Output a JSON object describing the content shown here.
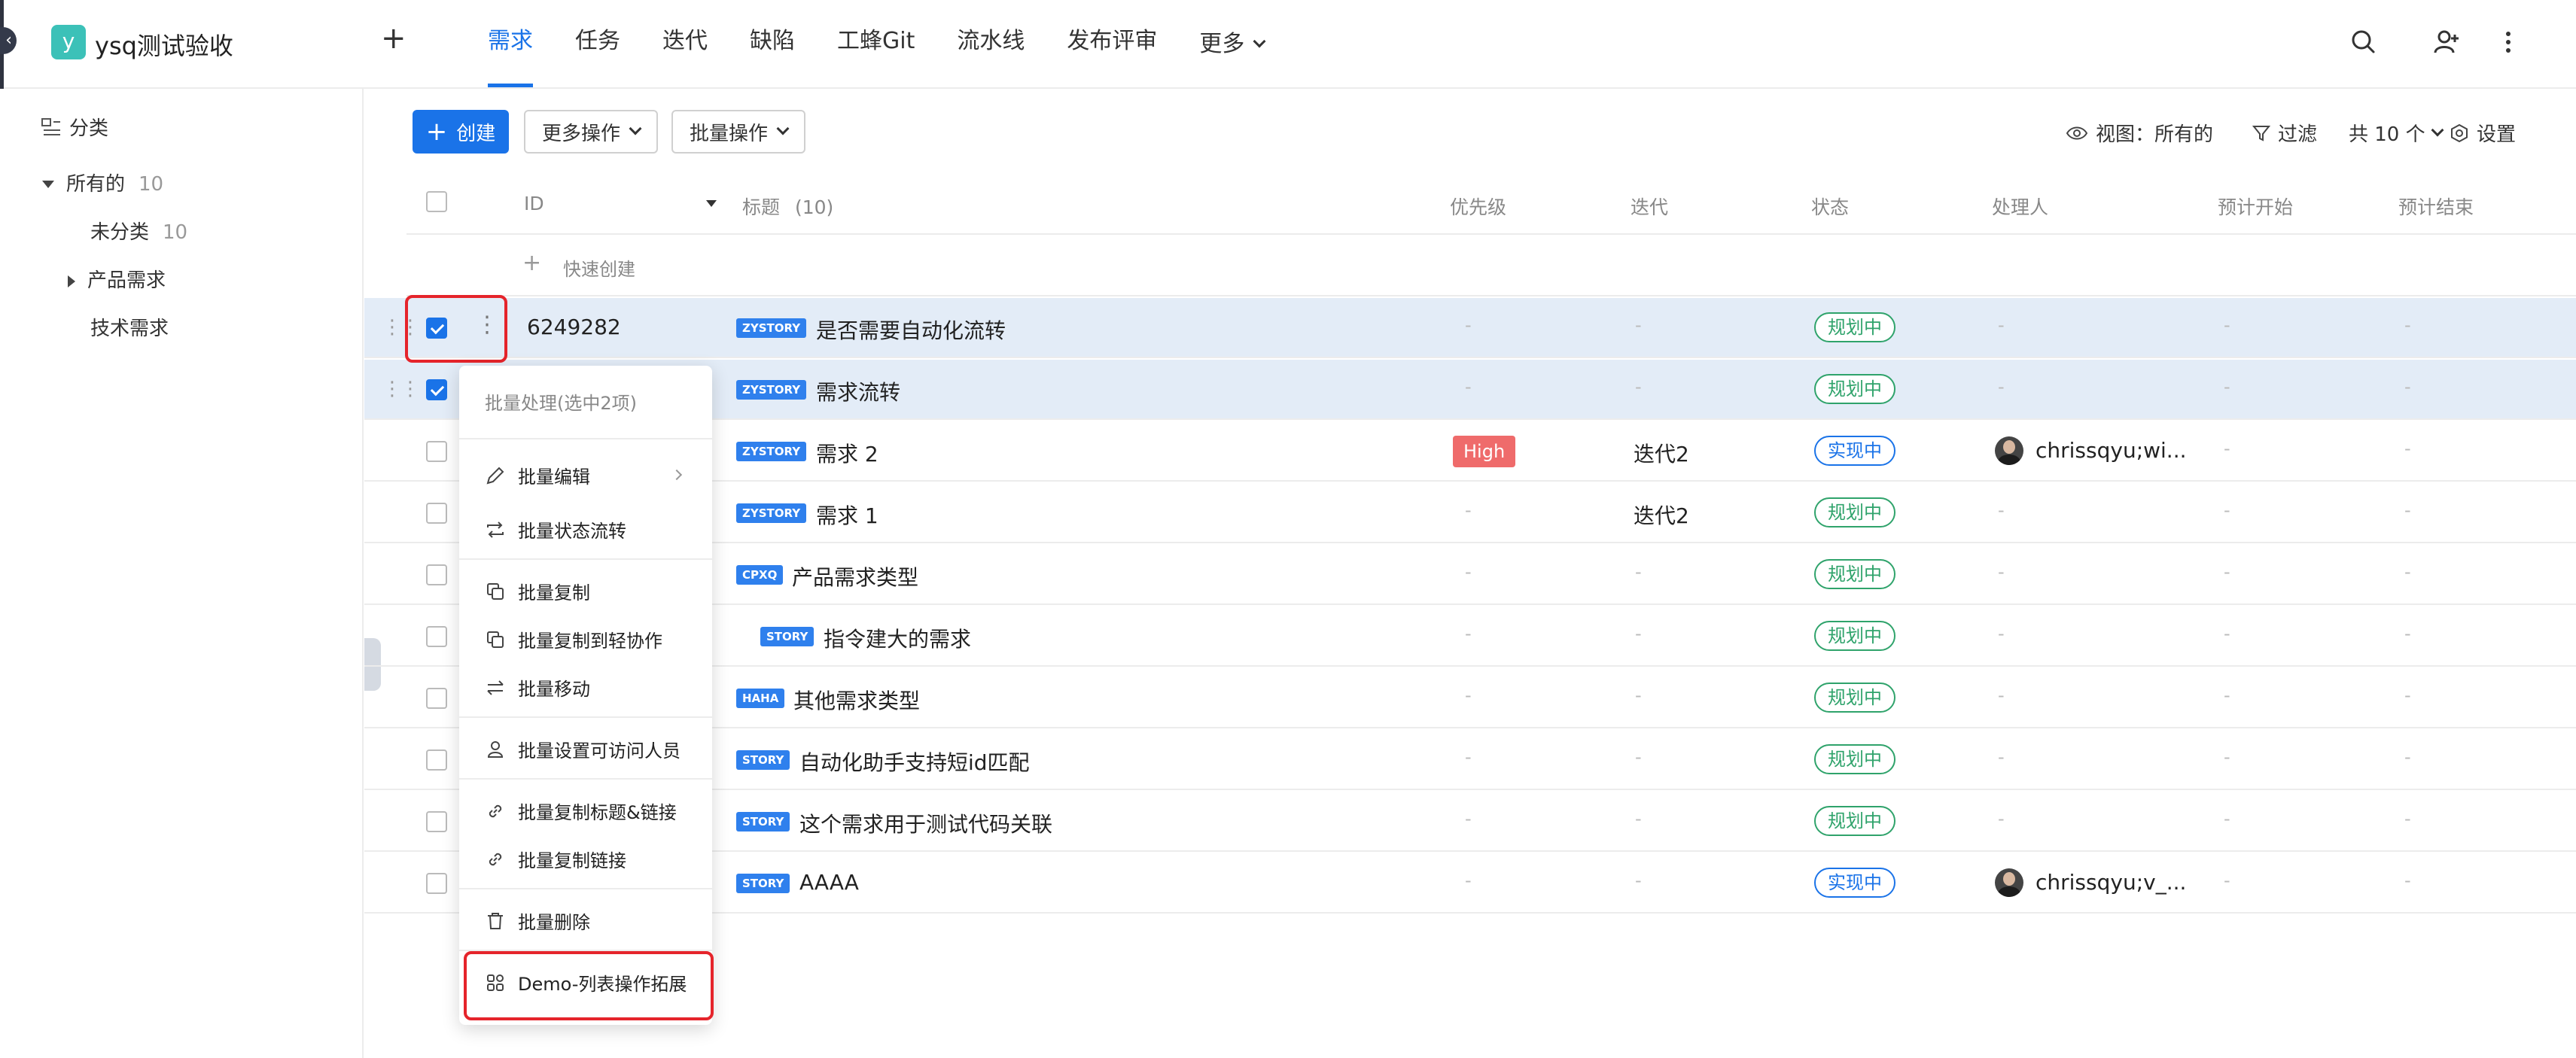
{
  "app": {
    "logo_letter": "y",
    "project_name": "ysq测试验收",
    "plus": "+"
  },
  "nav": {
    "tabs": [
      {
        "label": "需求",
        "active": true
      },
      {
        "label": "任务"
      },
      {
        "label": "迭代"
      },
      {
        "label": "缺陷"
      },
      {
        "label": "工蜂Git"
      },
      {
        "label": "流水线"
      },
      {
        "label": "发布评审"
      },
      {
        "label": "更多"
      }
    ],
    "accent_color": "#1a73e8"
  },
  "sidebar": {
    "header": "分类",
    "items": [
      {
        "label": "所有的",
        "count": "10"
      },
      {
        "label": "未分类",
        "count": "10"
      },
      {
        "label": "产品需求"
      },
      {
        "label": "技术需求"
      }
    ]
  },
  "toolbar": {
    "create": "创建",
    "more_ops": "更多操作",
    "batch_ops": "批量操作",
    "view": "视图：所有的",
    "filter": "过滤",
    "total": "共 10 个",
    "settings": "设置"
  },
  "table": {
    "columns": [
      "ID",
      "标题",
      "(10)",
      "优先级",
      "迭代",
      "状态",
      "处理人",
      "预计开始",
      "预计结束"
    ],
    "quick_create": "快速创建",
    "dash": "-",
    "rows": [
      {
        "id": "6249282",
        "tag": "ZYSTORY",
        "title": "是否需要自动化流转",
        "status": "规划中",
        "selected": true
      },
      {
        "tag": "ZYSTORY",
        "title": "需求流转",
        "status": "规划中",
        "selected": true
      },
      {
        "tag": "ZYSTORY",
        "title": "需求 2",
        "priority": "High",
        "iteration": "迭代2",
        "status": "实现中",
        "assignee": "chrissqyu;wi..."
      },
      {
        "tag": "ZYSTORY",
        "title": "需求 1",
        "iteration": "迭代2",
        "status": "规划中"
      },
      {
        "tag": "CPXQ",
        "title": "产品需求类型",
        "status": "规划中"
      },
      {
        "tag": "STORY",
        "title": "指令建大的需求",
        "status": "规划中"
      },
      {
        "tag": "HAHA",
        "title": "其他需求类型",
        "status": "规划中"
      },
      {
        "tag": "STORY",
        "title": "自动化助手支持短id匹配",
        "status": "规划中"
      },
      {
        "tag": "STORY",
        "title": "这个需求用于测试代码关联",
        "status": "规划中"
      },
      {
        "tag": "STORY",
        "title": "AAAA",
        "status": "实现中",
        "assignee": "chrissqyu;v_..."
      }
    ]
  },
  "batch_menu": {
    "header": "批量处理(选中2项)",
    "items": [
      {
        "label": "批量编辑",
        "icon": "pencil-icon"
      },
      {
        "label": "批量状态流转",
        "icon": "repeat-icon"
      },
      {
        "label": "批量复制",
        "icon": "copy-icon"
      },
      {
        "label": "批量复制到轻协作",
        "icon": "copy-icon"
      },
      {
        "label": "批量移动",
        "icon": "swap-icon"
      },
      {
        "label": "批量设置可访问人员",
        "icon": "user-icon"
      },
      {
        "label": "批量复制标题&链接",
        "icon": "link-icon"
      },
      {
        "label": "批量复制链接",
        "icon": "link-icon"
      },
      {
        "label": "批量删除",
        "icon": "trash-icon"
      },
      {
        "label": "Demo-列表操作拓展",
        "icon": "grid-icon"
      }
    ]
  },
  "colors": {
    "planning": "#2fa36b",
    "in_progress": "#1a73e8",
    "high_priority": "#ef6b6b",
    "highlight": "#e5242b",
    "selected_row": "#e3ecf7"
  }
}
